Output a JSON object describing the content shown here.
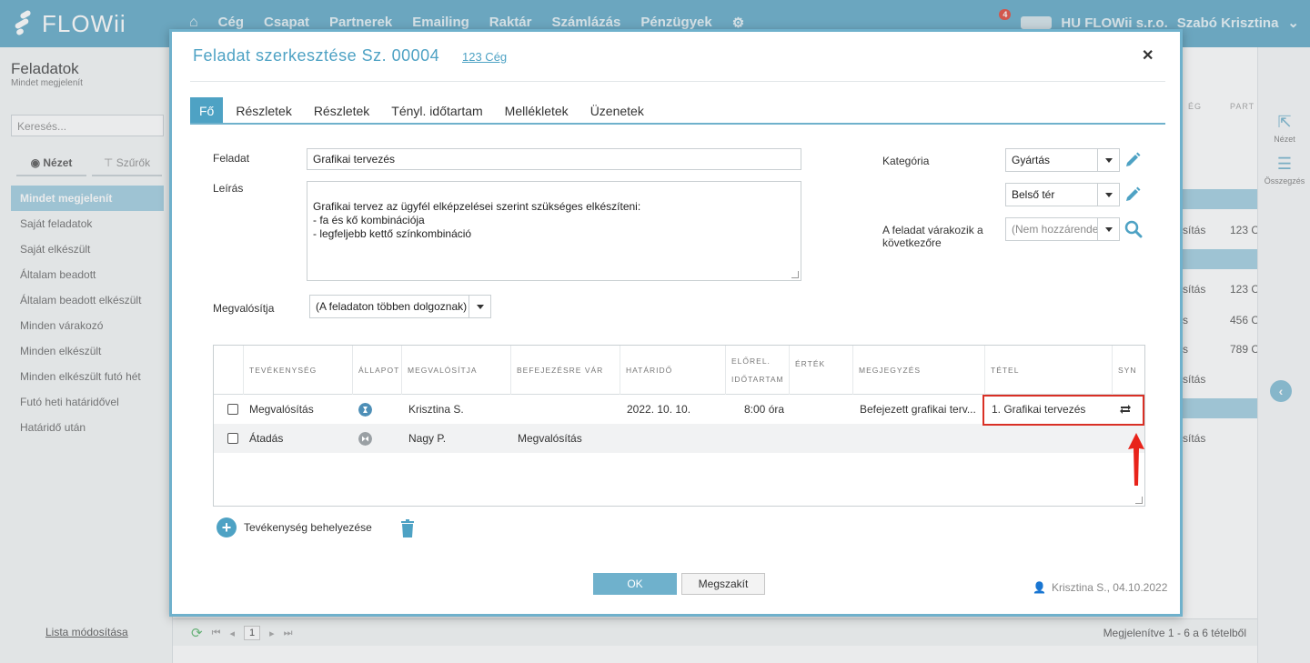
{
  "app": {
    "logo": "FLOWii",
    "nav": [
      "Cég",
      "Csapat",
      "Partnerek",
      "Emailing",
      "Raktár",
      "Számlázás",
      "Pénzügyek"
    ],
    "notification_count": "4",
    "company": "HU FLOWii s.r.o.",
    "user": "Szabó Krisztina"
  },
  "sidebar": {
    "title": "Feladatok",
    "subtitle": "Mindet megjelenít",
    "search_placeholder": "Keresés...",
    "view_tab": "Nézet",
    "filter_tab": "Szűrők",
    "items": [
      {
        "label": "Mindet megjelenít",
        "active": true
      },
      {
        "label": "Saját feladatok"
      },
      {
        "label": "Saját elkészült"
      },
      {
        "label": "Általam beadott"
      },
      {
        "label": "Általam beadott elkészült"
      },
      {
        "label": "Minden várakozó"
      },
      {
        "label": "Minden elkészült"
      },
      {
        "label": "Minden elkészült futó hét"
      },
      {
        "label": "Futó heti határidővel"
      },
      {
        "label": "Határidő után"
      }
    ],
    "footer_link": "Lista módosítása"
  },
  "background": {
    "col_heads": [
      "ÉG",
      "PART"
    ],
    "rows": [
      {
        "a": "sítás",
        "b": "123 C"
      },
      {
        "a": "sítás",
        "b": "123 C"
      },
      {
        "a": "s",
        "b": "456 C"
      },
      {
        "a": "s",
        "b": "789 C"
      },
      {
        "a": "sítás",
        "b": ""
      },
      {
        "a": "sítás",
        "b": ""
      }
    ],
    "rail_view": "Nézet",
    "rail_summary": "Összegzés",
    "page": "1",
    "display_info": "Megjelenítve 1 - 6 a 6 tételből"
  },
  "modal": {
    "title": "Feladat szerkesztése Sz. 00004",
    "company_link": "123 Cég",
    "tabs": [
      "Fő",
      "Részletek",
      "Részletek",
      "Tényl. időtartam",
      "Mellékletek",
      "Üzenetek"
    ],
    "fields": {
      "task_label": "Feladat",
      "task_value": "Grafikai tervezés",
      "desc_label": "Leírás",
      "desc_value": "Grafikai tervez az ügyfél elképzelései szerint szükséges elkészíteni:\n- fa és kő kombinációja\n- legfeljebb kettő színkombináció",
      "performer_label": "Megvalósítja",
      "performer_value": "(A feladaton többen dolgoznak)",
      "category_label": "Kategória",
      "category_value": "Gyártás",
      "subcategory_value": "Belső tér",
      "waits_label": "A feladat várakozik a következőre",
      "waits_value": "(Nem hozzárendelt)"
    },
    "grid": {
      "headers": {
        "activity": "TEVÉKENYSÉG",
        "status": "ÁLLAPOT",
        "performer": "MEGVALÓSÍTJA",
        "waits": "BEFEJEZÉSRE VÁR",
        "deadline": "HATÁRIDŐ",
        "est1": "ELŐREL.",
        "est2": "IDŐTARTAM",
        "value": "ÉRTÉK",
        "note": "MEGJEGYZÉS",
        "item": "TÉTEL",
        "syn": "SYN"
      },
      "rows": [
        {
          "activity": "Megvalósítás",
          "status_color": "#4e8fb7",
          "performer": "Krisztina S.",
          "waits": "",
          "deadline": "2022. 10. 10.",
          "duration": "8:00 óra",
          "value": "",
          "note": "Befejezett grafikai terv...",
          "item": "1. Grafikai tervezés",
          "syn": "sync-icon"
        },
        {
          "activity": "Átadás",
          "status_color": "#9aa0a4",
          "performer": "Nagy P.",
          "waits": "Megvalósítás",
          "deadline": "",
          "duration": "",
          "value": "",
          "note": "",
          "item": "",
          "syn": ""
        }
      ]
    },
    "add_activity": "Tevékenység behelyezése",
    "ok": "OK",
    "cancel": "Megszakít",
    "creator": "Krisztina S., 04.10.2022",
    "accent": "#4ea2c4",
    "highlight_color": "#d93025"
  }
}
